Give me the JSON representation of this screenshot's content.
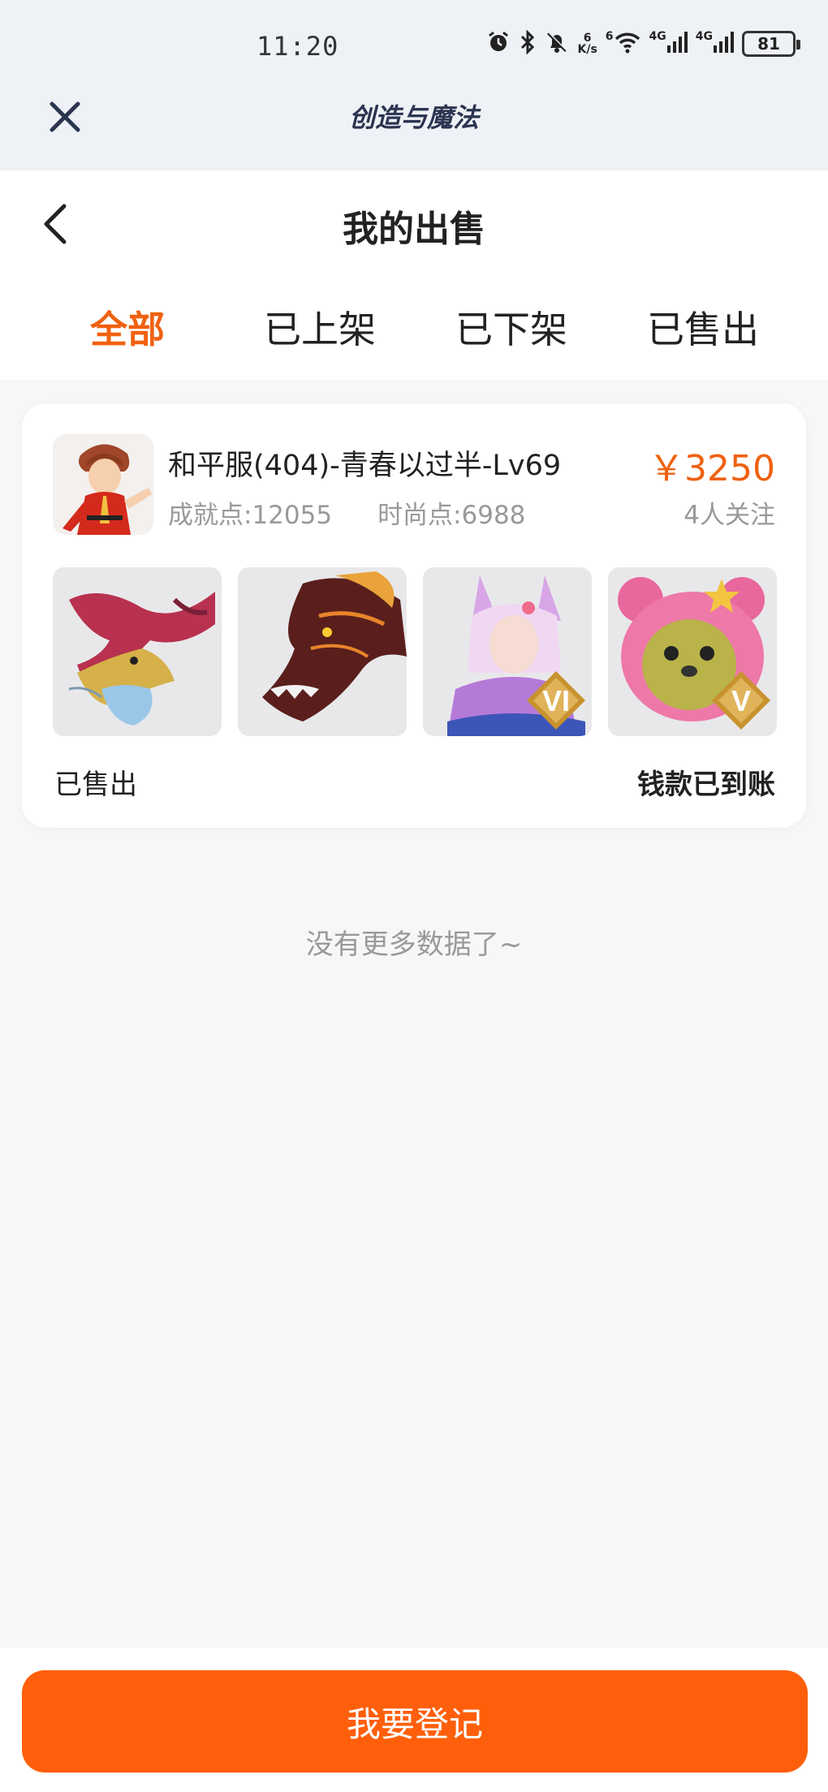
{
  "status_bar": {
    "time": "11:20",
    "net_speed_value": "6",
    "net_speed_unit": "K/s",
    "wifi_num": "6",
    "signal1_label": "4G",
    "signal2_label": "4G",
    "battery": "81",
    "icons": [
      "alarm-icon",
      "bluetooth-icon",
      "bell-muted-icon",
      "wifi-icon",
      "signal-icon",
      "battery-icon"
    ]
  },
  "app_bar": {
    "title": "创造与魔法"
  },
  "header": {
    "title": "我的出售"
  },
  "tabs": [
    {
      "label": "全部",
      "active": true
    },
    {
      "label": "已上架",
      "active": false
    },
    {
      "label": "已下架",
      "active": false
    },
    {
      "label": "已售出",
      "active": false
    }
  ],
  "listing": {
    "title": "和平服(404)-青春以过半-Lv69",
    "achievement": "成就点:12055",
    "fashion": "时尚点:6988",
    "price": "￥3250",
    "followers": "4人关注",
    "thumbnails": [
      {
        "name": "ice-dragon-mount",
        "badge": ""
      },
      {
        "name": "fire-dragon-mount",
        "badge": ""
      },
      {
        "name": "fox-girl-outfit",
        "badge": "VI"
      },
      {
        "name": "pink-bear-outfit",
        "badge": "V"
      }
    ],
    "status": "已售出",
    "payment_status": "钱款已到账"
  },
  "footer_note": "没有更多数据了~",
  "bottom_button": {
    "label": "我要登记"
  },
  "colors": {
    "accent": "#f06110",
    "button": "#ff5f0a",
    "muted_text": "#999999",
    "page_bg": "#f7f7f8"
  }
}
